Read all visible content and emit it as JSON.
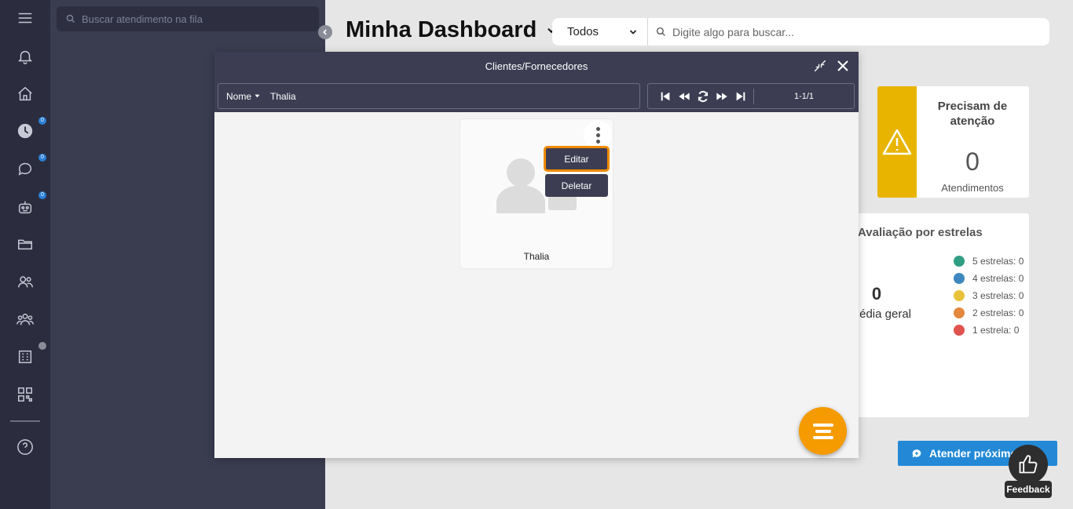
{
  "queue": {
    "search_placeholder": "Buscar atendimento na fila"
  },
  "rail": {
    "badges": {
      "clock": "0",
      "chat": "0",
      "bot": "0"
    }
  },
  "dashboard": {
    "title": "Minha Dashboard",
    "filter_select": "Todos",
    "search_placeholder": "Digite algo para buscar..."
  },
  "attention_card": {
    "title": "Precisam de atenção",
    "value": "0",
    "label": "Atendimentos"
  },
  "stars_card": {
    "title": "Avaliação por estrelas",
    "average": "0",
    "average_label": "édia geral",
    "legend": [
      {
        "label": "5 estrelas: 0",
        "color": "#2f9e82"
      },
      {
        "label": "4 estrelas: 0",
        "color": "#3d88bf"
      },
      {
        "label": "3 estrelas: 0",
        "color": "#e8c23a"
      },
      {
        "label": "2 estrelas: 0",
        "color": "#e3883c"
      },
      {
        "label": "1 estrela: 0",
        "color": "#e0534f"
      }
    ]
  },
  "atender_button": "Atender próximo",
  "feedback": {
    "label": "Feedback"
  },
  "modal": {
    "title": "Clientes/Fornecedores",
    "filter_field": "Nome",
    "filter_value": "Thalia",
    "pager_info": "1-1/1",
    "card": {
      "name": "Thalia",
      "menu_edit": "Editar",
      "menu_delete": "Deletar"
    }
  },
  "colors": {
    "rail": "#2b2d3e",
    "modal_header": "#3c3d52",
    "accent_orange": "#f59b00",
    "warning_yellow": "#e8b400",
    "primary_blue": "#2389d6"
  }
}
